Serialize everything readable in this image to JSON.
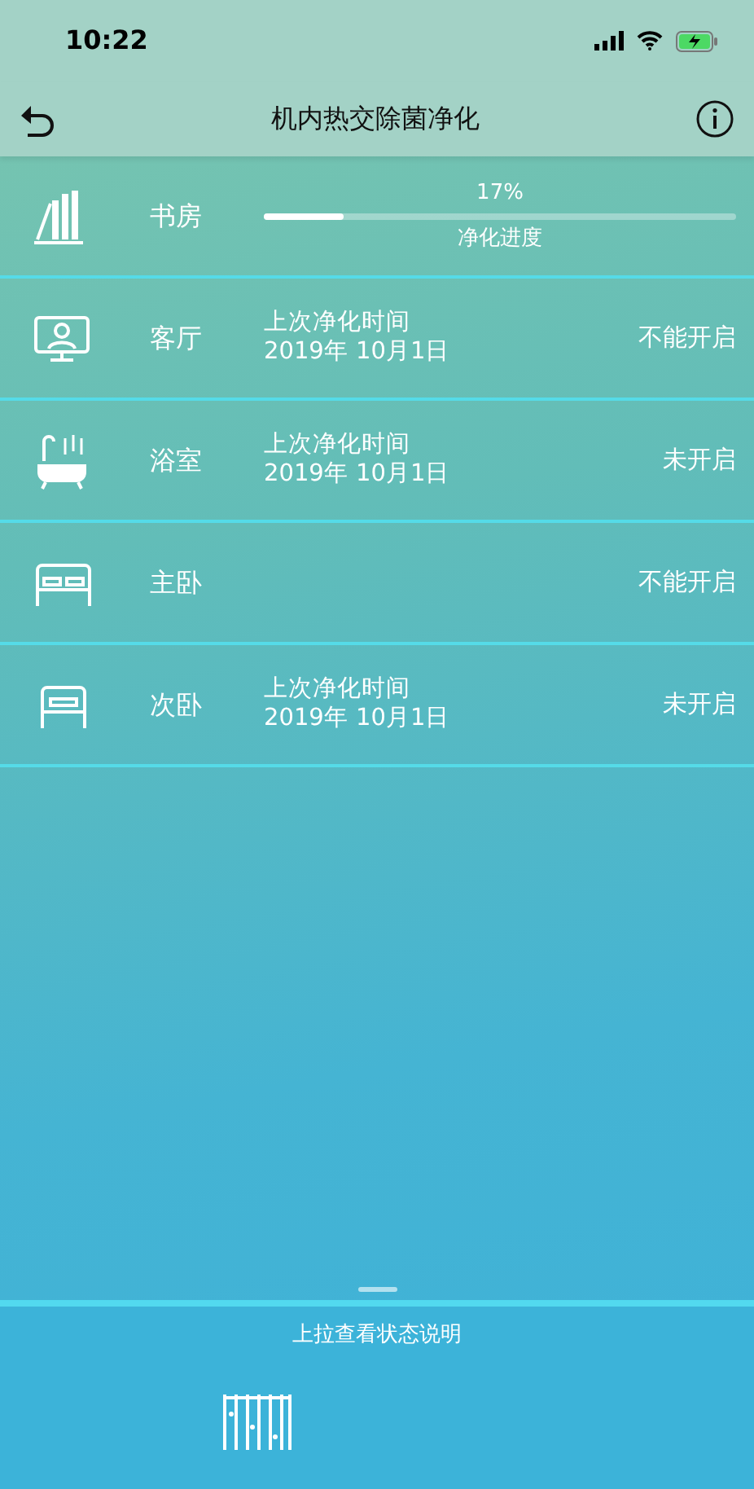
{
  "status_bar": {
    "time": "10:22"
  },
  "header": {
    "title": "机内热交除菌净化"
  },
  "rooms": [
    {
      "kind": "progress",
      "name": "书房",
      "reading": "17%",
      "level": 0.17,
      "caption": "净化进度"
    },
    {
      "kind": "history",
      "name": "客厅",
      "last_label": "上次净化时间",
      "last_date": "2019年 10月1日",
      "status": "不能开启"
    },
    {
      "kind": "history",
      "name": "浴室",
      "last_label": "上次净化时间",
      "last_date": "2019年 10月1日",
      "status": "未开启"
    },
    {
      "kind": "plain",
      "name": "主卧",
      "status": "不能开启"
    },
    {
      "kind": "history",
      "name": "次卧",
      "last_label": "上次净化时间",
      "last_date": "2019年 10月1日",
      "status": "未开启"
    }
  ],
  "bottom_panel": {
    "hint": "上拉查看状态说明"
  }
}
